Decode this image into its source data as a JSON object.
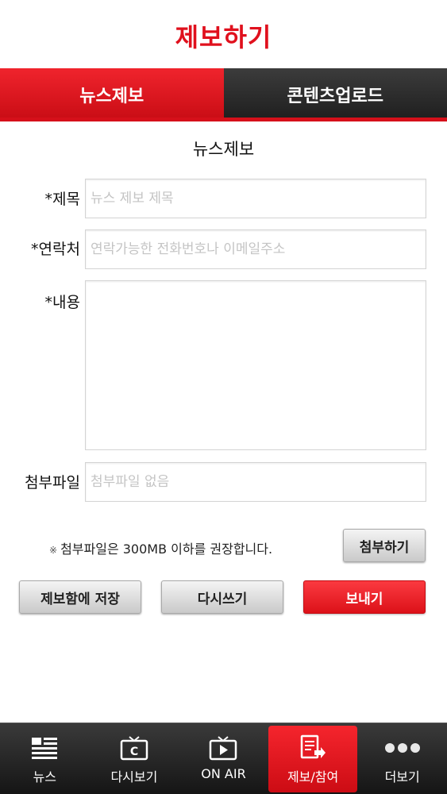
{
  "header": {
    "title": "제보하기"
  },
  "tabs": [
    {
      "label": "뉴스제보",
      "active": true
    },
    {
      "label": "콘텐츠업로드",
      "active": false
    }
  ],
  "form": {
    "title": "뉴스제보",
    "subject": {
      "label": "*제목",
      "placeholder": "뉴스 제보 제목",
      "value": ""
    },
    "contact": {
      "label": "*연락처",
      "placeholder": "연락가능한 전화번호나 이메일주소",
      "value": ""
    },
    "content": {
      "label": "*내용",
      "value": ""
    },
    "attachment": {
      "label": "첨부파일",
      "placeholder": "첨부파일 없음",
      "value": ""
    },
    "notice_mark": "※",
    "notice": "첨부파일은 300MB 이하를 권장합니다.",
    "attach_button": "첨부하기",
    "save_button": "제보함에 저장",
    "reset_button": "다시쓰기",
    "send_button": "보내기"
  },
  "bottom_nav": [
    {
      "label": "뉴스",
      "icon": "news-list-icon",
      "active": false
    },
    {
      "label": "다시보기",
      "icon": "tv-replay-icon",
      "active": false
    },
    {
      "label": "ON AIR",
      "icon": "tv-play-icon",
      "active": false
    },
    {
      "label": "제보/참여",
      "icon": "report-document-icon",
      "active": true
    },
    {
      "label": "더보기",
      "icon": "more-dots-icon",
      "active": false
    }
  ],
  "colors": {
    "accent": "#e0101d",
    "tab_bar_dark": "#2a2a2a"
  }
}
